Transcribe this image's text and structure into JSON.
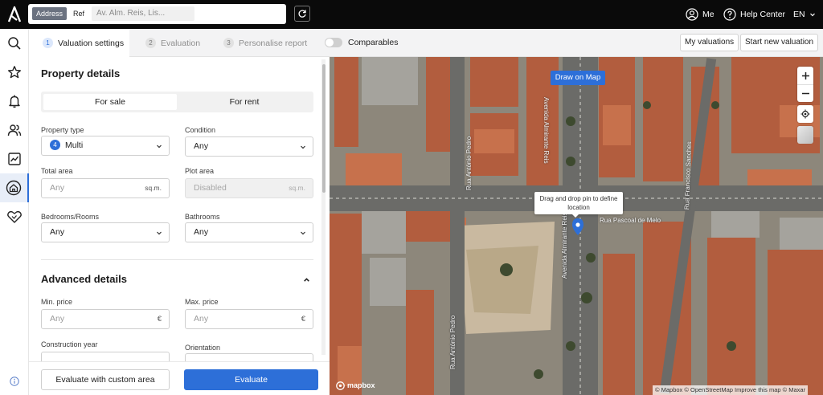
{
  "header": {
    "seg_address": "Address",
    "seg_ref": "Ref",
    "address_value": "Av. Alm. Reis, Lis...",
    "me_label": "Me",
    "help_label": "Help Center",
    "lang_label": "EN"
  },
  "tabs": {
    "steps": [
      {
        "num": "1",
        "label": "Valuation settings"
      },
      {
        "num": "2",
        "label": "Evaluation"
      },
      {
        "num": "3",
        "label": "Personalise report"
      }
    ],
    "comparables_label": "Comparables",
    "my_valuations_label": "My valuations",
    "new_valuation_label": "Start new valuation"
  },
  "form": {
    "property_details_title": "Property details",
    "for_sale_label": "For sale",
    "for_rent_label": "For rent",
    "property_type_label": "Property type",
    "property_type_count": "4",
    "property_type_value": "Multi",
    "condition_label": "Condition",
    "condition_value": "Any",
    "total_area_label": "Total area",
    "total_area_placeholder": "Any",
    "total_area_unit": "sq.m.",
    "plot_area_label": "Plot area",
    "plot_area_value": "Disabled",
    "plot_area_unit": "sq.m.",
    "bedrooms_label": "Bedrooms/Rooms",
    "bedrooms_value": "Any",
    "bathrooms_label": "Bathrooms",
    "bathrooms_value": "Any",
    "advanced_title": "Advanced details",
    "min_price_label": "Min. price",
    "min_price_placeholder": "Any",
    "min_price_unit": "€",
    "max_price_label": "Max. price",
    "max_price_placeholder": "Any",
    "max_price_unit": "€",
    "construction_year_label": "Construction year",
    "orientation_label": "Orientation"
  },
  "footer": {
    "custom_area_label": "Evaluate with custom area",
    "evaluate_label": "Evaluate"
  },
  "map": {
    "draw_button_label": "Draw on Map",
    "pin_tooltip_line1": "Drag and drop pin to define",
    "pin_tooltip_line2": "location",
    "streets": {
      "almirante_reis_top": "Avenida Almirante Reis",
      "almirante_reis_bottom": "Avenida Almirante Reis",
      "antonio_pedro_top": "Rua António Pedro",
      "antonio_pedro_bottom": "Rua António Pedro",
      "pascoal_de_melo": "Rua Pascoal de Melo",
      "francisco_sanches": "Rua Francisco Sanches"
    },
    "mapbox_logo": "mapbox",
    "attribution": "© Mapbox © OpenStreetMap  Improve this map  © Maxar"
  },
  "colors": {
    "accent": "#2d6fd8",
    "topbar": "#0a0a0a"
  }
}
